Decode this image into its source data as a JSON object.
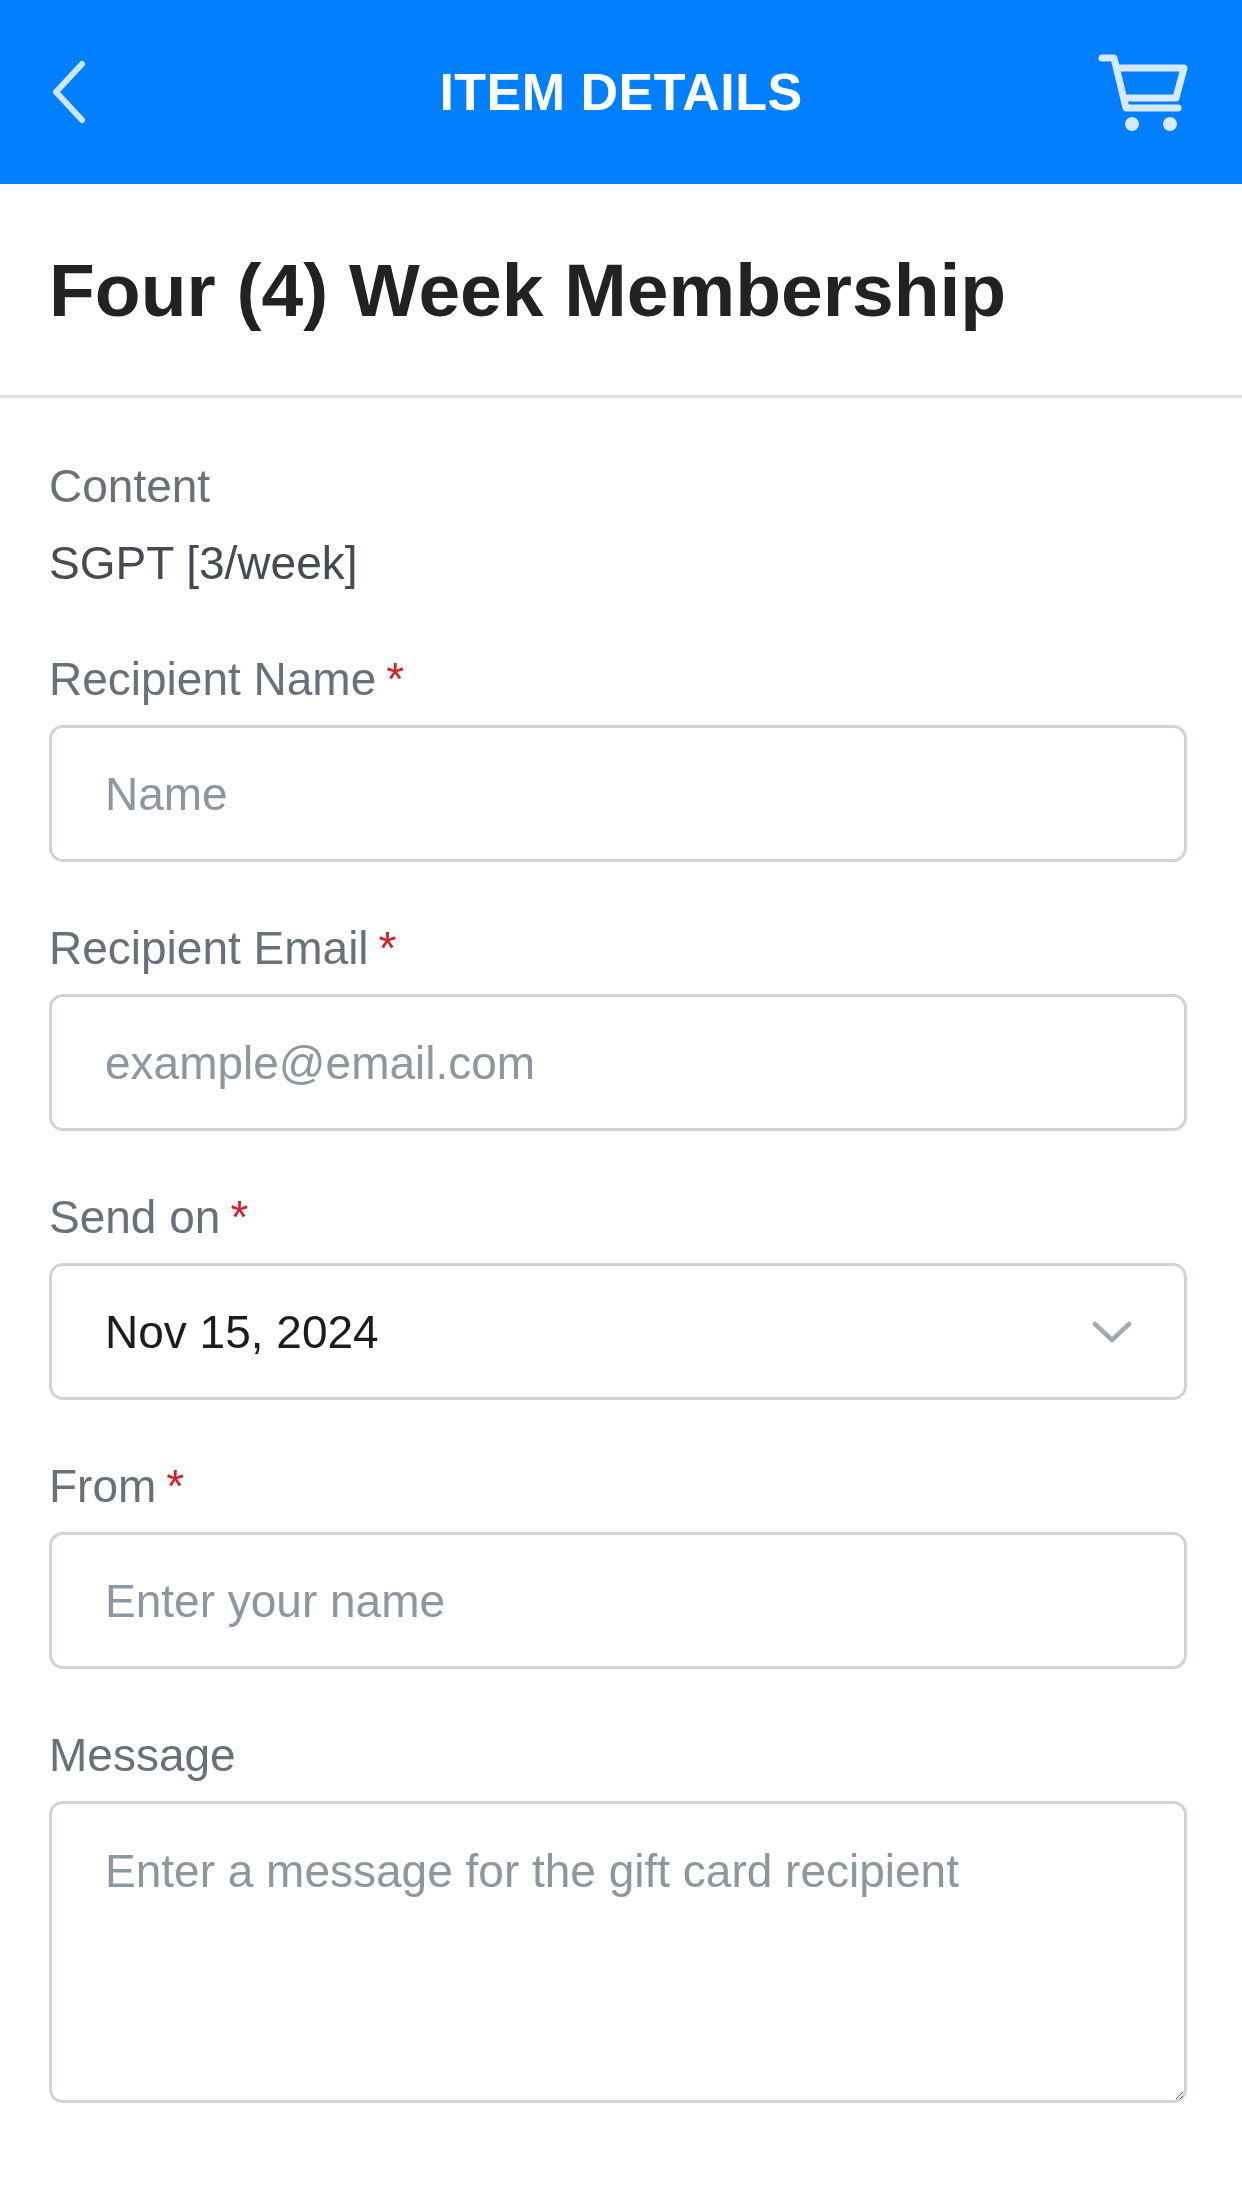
{
  "header": {
    "title": "ITEM DETAILS"
  },
  "item": {
    "title": "Four (4) Week Membership"
  },
  "content": {
    "label": "Content",
    "value": "SGPT [3/week]"
  },
  "form": {
    "fields": [
      {
        "kind": "text",
        "label": "Recipient Name",
        "required_mark": "*",
        "placeholder": "Name"
      },
      {
        "kind": "text",
        "label": "Recipient Email",
        "required_mark": "*",
        "placeholder": "example@email.com"
      },
      {
        "kind": "select",
        "label": "Send on",
        "required_mark": "*",
        "value": "Nov 15, 2024"
      },
      {
        "kind": "text",
        "label": "From",
        "required_mark": "*",
        "placeholder": "Enter your name"
      },
      {
        "kind": "textarea",
        "label": "Message",
        "placeholder": "Enter a message for the gift card recipient"
      }
    ]
  }
}
